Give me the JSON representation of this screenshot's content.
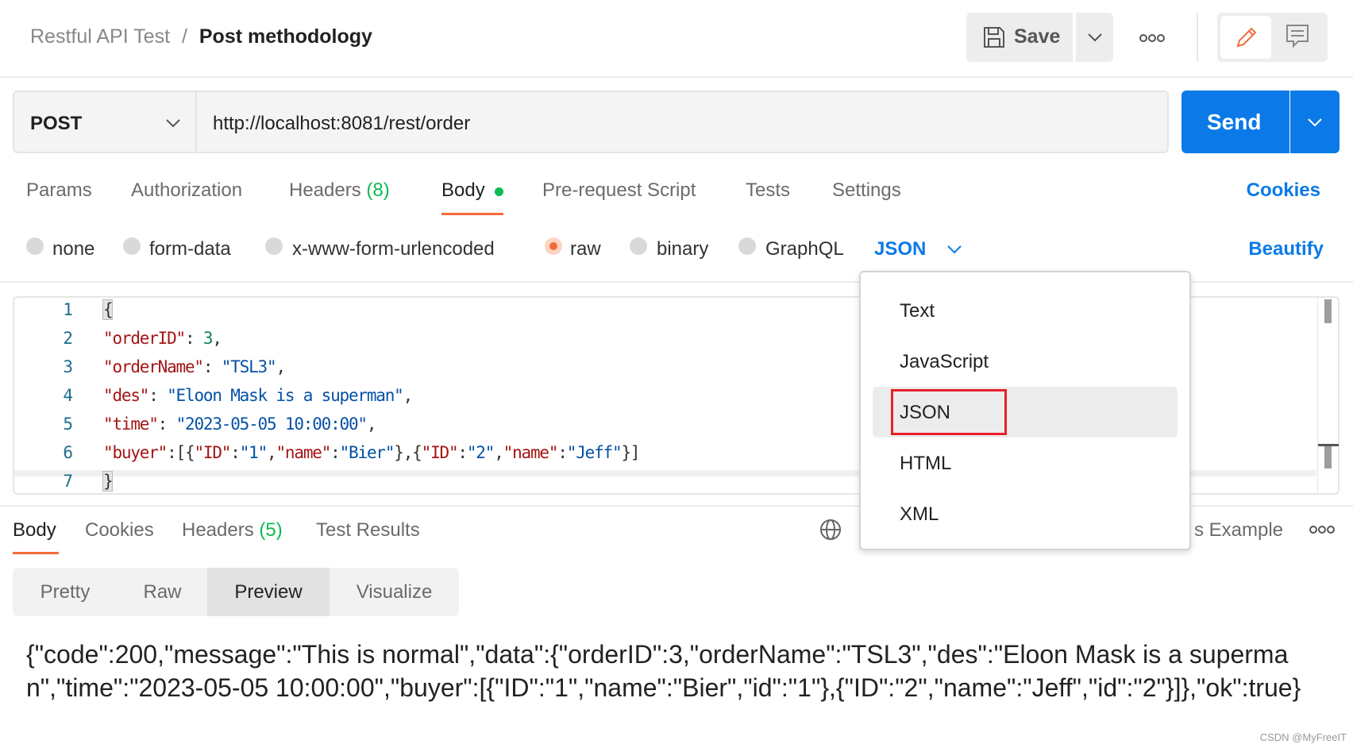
{
  "header": {
    "breadcrumb_parent": "Restful API Test",
    "separator": "/",
    "breadcrumb_current": "Post methodology",
    "save_label": "Save",
    "more_icon": "ellipsis-icon"
  },
  "request": {
    "method": "POST",
    "url": "http://localhost:8081/rest/order",
    "send_label": "Send"
  },
  "tabs": [
    {
      "label": "Params"
    },
    {
      "label": "Authorization"
    },
    {
      "label": "Headers",
      "count": "(8)"
    },
    {
      "label": "Body",
      "active": true
    },
    {
      "label": "Pre-request Script"
    },
    {
      "label": "Tests"
    },
    {
      "label": "Settings"
    }
  ],
  "cookies_label": "Cookies",
  "body_types": [
    {
      "label": "none"
    },
    {
      "label": "form-data"
    },
    {
      "label": "x-www-form-urlencoded"
    },
    {
      "label": "raw",
      "selected": true
    },
    {
      "label": "binary"
    },
    {
      "label": "GraphQL"
    }
  ],
  "raw_format": "JSON",
  "beautify_label": "Beautify",
  "editor": {
    "line_numbers": [
      "1",
      "2",
      "3",
      "4",
      "5",
      "6",
      "7"
    ],
    "lines": [
      [
        {
          "t": "p",
          "v": "{"
        }
      ],
      [
        {
          "t": "k",
          "v": "\"orderID\""
        },
        {
          "t": "p",
          "v": ": "
        },
        {
          "t": "n",
          "v": "3"
        },
        {
          "t": "p",
          "v": ","
        }
      ],
      [
        {
          "t": "k",
          "v": "\"orderName\""
        },
        {
          "t": "p",
          "v": ": "
        },
        {
          "t": "s",
          "v": "\"TSL3\""
        },
        {
          "t": "p",
          "v": ","
        }
      ],
      [
        {
          "t": "k",
          "v": "\"des\""
        },
        {
          "t": "p",
          "v": ": "
        },
        {
          "t": "s",
          "v": "\"Eloon Mask is a superman\""
        },
        {
          "t": "p",
          "v": ","
        }
      ],
      [
        {
          "t": "k",
          "v": "\"time\""
        },
        {
          "t": "p",
          "v": ": "
        },
        {
          "t": "s",
          "v": "\"2023-05-05 10:00:00\""
        },
        {
          "t": "p",
          "v": ","
        }
      ],
      [
        {
          "t": "k",
          "v": "\"buyer\""
        },
        {
          "t": "p",
          "v": ":[{"
        },
        {
          "t": "k",
          "v": "\"ID\""
        },
        {
          "t": "p",
          "v": ":"
        },
        {
          "t": "s",
          "v": "\"1\""
        },
        {
          "t": "p",
          "v": ","
        },
        {
          "t": "k",
          "v": "\"name\""
        },
        {
          "t": "p",
          "v": ":"
        },
        {
          "t": "s",
          "v": "\"Bier\""
        },
        {
          "t": "p",
          "v": "},{"
        },
        {
          "t": "k",
          "v": "\"ID\""
        },
        {
          "t": "p",
          "v": ":"
        },
        {
          "t": "s",
          "v": "\"2\""
        },
        {
          "t": "p",
          "v": ","
        },
        {
          "t": "k",
          "v": "\"name\""
        },
        {
          "t": "p",
          "v": ":"
        },
        {
          "t": "s",
          "v": "\"Jeff\""
        },
        {
          "t": "p",
          "v": "}]"
        }
      ],
      [
        {
          "t": "p",
          "v": "}"
        }
      ]
    ]
  },
  "format_menu": {
    "items": [
      "Text",
      "JavaScript",
      "JSON",
      "HTML",
      "XML"
    ],
    "selected": "JSON",
    "highlight_color": "#e8202a"
  },
  "response": {
    "tabs": [
      {
        "label": "Body",
        "active": true
      },
      {
        "label": "Cookies"
      },
      {
        "label": "Headers",
        "count": "(5)"
      },
      {
        "label": "Test Results"
      }
    ],
    "save_example_partial": "s Example",
    "views": [
      "Pretty",
      "Raw",
      "Preview",
      "Visualize"
    ],
    "active_view": "Preview",
    "body_text": "{\"code\":200,\"message\":\"This is normal\",\"data\":{\"orderID\":3,\"orderName\":\"TSL3\",\"des\":\"Eloon Mask is a superman\",\"time\":\"2023-05-05 10:00:00\",\"buyer\":[{\"ID\":\"1\",\"name\":\"Bier\",\"id\":\"1\"},{\"ID\":\"2\",\"name\":\"Jeff\",\"id\":\"2\"}]},\"ok\":true}"
  },
  "watermark": "CSDN @MyFreeIT",
  "colors": {
    "accent": "#0b7ae8",
    "tab_underline": "#f26b3a",
    "green": "#0cbb52",
    "pencil": "#f26b3a"
  }
}
